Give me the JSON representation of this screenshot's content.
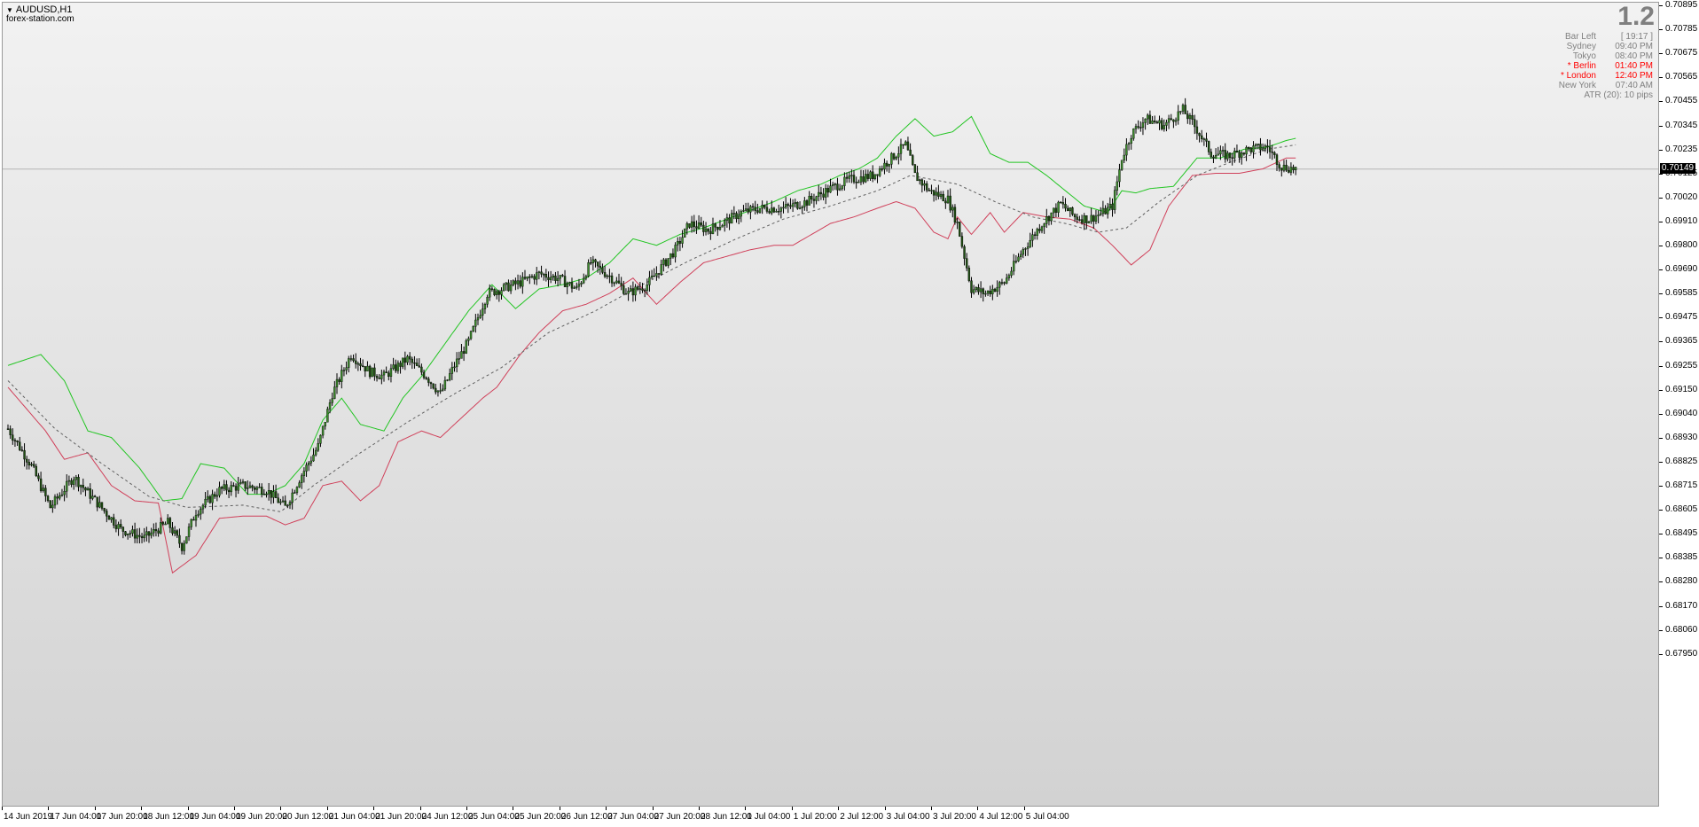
{
  "window": {
    "symbol": "AUDUSD,H1",
    "source": "forex-station.com"
  },
  "info_panel": {
    "big_value": "1.2",
    "rows": [
      {
        "label": "Bar Left",
        "value": "[ 19:17 ]",
        "color": "#808080"
      },
      {
        "label": "Sydney",
        "value": "09:40 PM",
        "color": "#808080"
      },
      {
        "label": "Tokyo",
        "value": "08:40 PM",
        "color": "#808080"
      },
      {
        "label": "* Berlin",
        "value": "01:40 PM",
        "color": "#ff0000"
      },
      {
        "label": "* London",
        "value": "12:40 PM",
        "color": "#ff0000"
      },
      {
        "label": "New York",
        "value": "07:40 AM",
        "color": "#808080"
      }
    ],
    "atr": "ATR (20): 10 pips"
  },
  "price_axis": {
    "labels": [
      "0.70895",
      "0.70785",
      "0.70675",
      "0.70565",
      "0.70455",
      "0.70345",
      "0.70235",
      "0.70125",
      "0.70020",
      "0.69910",
      "0.69800",
      "0.69690",
      "0.69585",
      "0.69475",
      "0.69365",
      "0.69255",
      "0.69150",
      "0.69040",
      "0.68930",
      "0.68825",
      "0.68715",
      "0.68605",
      "0.68495",
      "0.68385",
      "0.68280",
      "0.68170",
      "0.68060",
      "0.67950"
    ],
    "current_price": "0.70149"
  },
  "time_axis": {
    "labels": [
      "14 Jun 2019",
      "17 Jun 04:00",
      "17 Jun 20:00",
      "18 Jun 12:00",
      "19 Jun 04:00",
      "19 Jun 20:00",
      "20 Jun 12:00",
      "21 Jun 04:00",
      "21 Jun 20:00",
      "24 Jun 12:00",
      "25 Jun 04:00",
      "25 Jun 20:00",
      "26 Jun 12:00",
      "27 Jun 04:00",
      "27 Jun 20:00",
      "28 Jun 12:00",
      "1 Jul 04:00",
      "1 Jul 20:00",
      "2 Jul 12:00",
      "3 Jul 04:00",
      "3 Jul 20:00",
      "4 Jul 12:00",
      "5 Jul 04:00"
    ]
  },
  "chart_data": {
    "type": "candlestick",
    "symbol": "AUDUSD",
    "timeframe": "H1",
    "ylim": [
      0.679,
      0.7094
    ],
    "price_path": [
      [
        0,
        0.6896
      ],
      [
        10,
        0.6879
      ],
      [
        18,
        0.686
      ],
      [
        28,
        0.6874
      ],
      [
        38,
        0.6862
      ],
      [
        48,
        0.685
      ],
      [
        58,
        0.6846
      ],
      [
        68,
        0.6853
      ],
      [
        74,
        0.6842
      ],
      [
        80,
        0.6858
      ],
      [
        90,
        0.6868
      ],
      [
        100,
        0.687
      ],
      [
        110,
        0.6868
      ],
      [
        118,
        0.686
      ],
      [
        124,
        0.6873
      ],
      [
        132,
        0.6888
      ],
      [
        138,
        0.6912
      ],
      [
        146,
        0.693
      ],
      [
        154,
        0.6922
      ],
      [
        160,
        0.692
      ],
      [
        170,
        0.6928
      ],
      [
        178,
        0.692
      ],
      [
        184,
        0.6912
      ],
      [
        190,
        0.6925
      ],
      [
        196,
        0.6936
      ],
      [
        204,
        0.6958
      ],
      [
        210,
        0.696
      ],
      [
        218,
        0.6963
      ],
      [
        226,
        0.6967
      ],
      [
        234,
        0.6965
      ],
      [
        242,
        0.696
      ],
      [
        248,
        0.6972
      ],
      [
        256,
        0.6966
      ],
      [
        264,
        0.6958
      ],
      [
        272,
        0.6962
      ],
      [
        278,
        0.697
      ],
      [
        284,
        0.6978
      ],
      [
        290,
        0.699
      ],
      [
        298,
        0.6987
      ],
      [
        304,
        0.699
      ],
      [
        312,
        0.6995
      ],
      [
        320,
        0.6997
      ],
      [
        330,
        0.6997
      ],
      [
        340,
        0.7
      ],
      [
        350,
        0.7006
      ],
      [
        358,
        0.701
      ],
      [
        368,
        0.7012
      ],
      [
        376,
        0.702
      ],
      [
        382,
        0.7026
      ],
      [
        386,
        0.7012
      ],
      [
        392,
        0.7005
      ],
      [
        400,
        0.7001
      ],
      [
        404,
        0.699
      ],
      [
        410,
        0.696
      ],
      [
        416,
        0.6958
      ],
      [
        424,
        0.6963
      ],
      [
        432,
        0.6978
      ],
      [
        440,
        0.699
      ],
      [
        448,
        0.6999
      ],
      [
        454,
        0.6993
      ],
      [
        460,
        0.6992
      ],
      [
        466,
        0.6995
      ],
      [
        470,
        0.6998
      ],
      [
        474,
        0.702
      ],
      [
        478,
        0.7031
      ],
      [
        484,
        0.7038
      ],
      [
        492,
        0.7035
      ],
      [
        500,
        0.7042
      ],
      [
        506,
        0.7033
      ],
      [
        512,
        0.7022
      ],
      [
        520,
        0.7021
      ],
      [
        528,
        0.7024
      ],
      [
        536,
        0.7025
      ],
      [
        542,
        0.7016
      ],
      [
        548,
        0.7015
      ]
    ],
    "upper_band": [
      [
        0,
        0.6925
      ],
      [
        14,
        0.693
      ],
      [
        24,
        0.6918
      ],
      [
        34,
        0.6895
      ],
      [
        44,
        0.6892
      ],
      [
        56,
        0.6878
      ],
      [
        66,
        0.6863
      ],
      [
        74,
        0.6864
      ],
      [
        82,
        0.688
      ],
      [
        92,
        0.6878
      ],
      [
        102,
        0.6866
      ],
      [
        110,
        0.6866
      ],
      [
        118,
        0.687
      ],
      [
        126,
        0.688
      ],
      [
        134,
        0.69
      ],
      [
        142,
        0.691
      ],
      [
        150,
        0.6898
      ],
      [
        160,
        0.6895
      ],
      [
        168,
        0.691
      ],
      [
        176,
        0.692
      ],
      [
        186,
        0.6935
      ],
      [
        196,
        0.695
      ],
      [
        206,
        0.6962
      ],
      [
        216,
        0.6951
      ],
      [
        226,
        0.696
      ],
      [
        236,
        0.6962
      ],
      [
        246,
        0.6965
      ],
      [
        256,
        0.6972
      ],
      [
        266,
        0.6983
      ],
      [
        276,
        0.698
      ],
      [
        286,
        0.6985
      ],
      [
        296,
        0.6988
      ],
      [
        306,
        0.6992
      ],
      [
        316,
        0.6996
      ],
      [
        326,
        0.7
      ],
      [
        336,
        0.7005
      ],
      [
        346,
        0.7008
      ],
      [
        354,
        0.7012
      ],
      [
        362,
        0.7015
      ],
      [
        370,
        0.702
      ],
      [
        378,
        0.703
      ],
      [
        386,
        0.7038
      ],
      [
        394,
        0.703
      ],
      [
        402,
        0.7032
      ],
      [
        410,
        0.7039
      ],
      [
        418,
        0.7022
      ],
      [
        426,
        0.7018
      ],
      [
        434,
        0.7018
      ],
      [
        442,
        0.7012
      ],
      [
        450,
        0.7005
      ],
      [
        458,
        0.6998
      ],
      [
        468,
        0.6995
      ],
      [
        474,
        0.7005
      ],
      [
        480,
        0.7004
      ],
      [
        486,
        0.7006
      ],
      [
        496,
        0.7007
      ],
      [
        506,
        0.702
      ],
      [
        516,
        0.702
      ],
      [
        526,
        0.7024
      ],
      [
        536,
        0.7025
      ],
      [
        544,
        0.7028
      ],
      [
        548,
        0.7029
      ]
    ],
    "lower_band": [
      [
        0,
        0.6915
      ],
      [
        8,
        0.6905
      ],
      [
        16,
        0.6895
      ],
      [
        24,
        0.6882
      ],
      [
        34,
        0.6885
      ],
      [
        44,
        0.687
      ],
      [
        54,
        0.6863
      ],
      [
        64,
        0.6862
      ],
      [
        70,
        0.683
      ],
      [
        80,
        0.6838
      ],
      [
        90,
        0.6855
      ],
      [
        100,
        0.6856
      ],
      [
        110,
        0.6856
      ],
      [
        118,
        0.6852
      ],
      [
        126,
        0.6855
      ],
      [
        134,
        0.687
      ],
      [
        142,
        0.6872
      ],
      [
        150,
        0.6863
      ],
      [
        158,
        0.687
      ],
      [
        166,
        0.689
      ],
      [
        176,
        0.6895
      ],
      [
        184,
        0.6892
      ],
      [
        194,
        0.6902
      ],
      [
        202,
        0.691
      ],
      [
        208,
        0.6915
      ],
      [
        218,
        0.693
      ],
      [
        226,
        0.694
      ],
      [
        236,
        0.695
      ],
      [
        246,
        0.6953
      ],
      [
        256,
        0.6958
      ],
      [
        266,
        0.6965
      ],
      [
        276,
        0.6953
      ],
      [
        286,
        0.6963
      ],
      [
        296,
        0.6972
      ],
      [
        306,
        0.6975
      ],
      [
        316,
        0.6978
      ],
      [
        326,
        0.698
      ],
      [
        334,
        0.698
      ],
      [
        342,
        0.6985
      ],
      [
        350,
        0.699
      ],
      [
        360,
        0.6993
      ],
      [
        370,
        0.6997
      ],
      [
        378,
        0.7
      ],
      [
        386,
        0.6997
      ],
      [
        394,
        0.6986
      ],
      [
        400,
        0.6983
      ],
      [
        404,
        0.6993
      ],
      [
        410,
        0.6985
      ],
      [
        418,
        0.6995
      ],
      [
        424,
        0.6986
      ],
      [
        432,
        0.6995
      ],
      [
        442,
        0.6993
      ],
      [
        452,
        0.6992
      ],
      [
        462,
        0.6988
      ],
      [
        470,
        0.698
      ],
      [
        478,
        0.6971
      ],
      [
        486,
        0.6978
      ],
      [
        494,
        0.6998
      ],
      [
        504,
        0.7012
      ],
      [
        514,
        0.7013
      ],
      [
        524,
        0.7013
      ],
      [
        534,
        0.7015
      ],
      [
        544,
        0.702
      ],
      [
        548,
        0.702
      ]
    ],
    "middle_band": [
      [
        0,
        0.6918
      ],
      [
        20,
        0.6896
      ],
      [
        40,
        0.688
      ],
      [
        60,
        0.6865
      ],
      [
        76,
        0.686
      ],
      [
        100,
        0.6861
      ],
      [
        116,
        0.6858
      ],
      [
        130,
        0.687
      ],
      [
        150,
        0.6885
      ],
      [
        170,
        0.6899
      ],
      [
        190,
        0.6912
      ],
      [
        210,
        0.6924
      ],
      [
        230,
        0.694
      ],
      [
        250,
        0.695
      ],
      [
        270,
        0.6962
      ],
      [
        290,
        0.6973
      ],
      [
        310,
        0.6983
      ],
      [
        330,
        0.6992
      ],
      [
        350,
        0.6998
      ],
      [
        370,
        0.7005
      ],
      [
        384,
        0.7012
      ],
      [
        394,
        0.701
      ],
      [
        404,
        0.7008
      ],
      [
        420,
        0.7
      ],
      [
        436,
        0.6993
      ],
      [
        450,
        0.699
      ],
      [
        464,
        0.6986
      ],
      [
        476,
        0.6988
      ],
      [
        490,
        0.7
      ],
      [
        506,
        0.7012
      ],
      [
        520,
        0.7018
      ],
      [
        536,
        0.7024
      ],
      [
        548,
        0.7026
      ]
    ]
  }
}
